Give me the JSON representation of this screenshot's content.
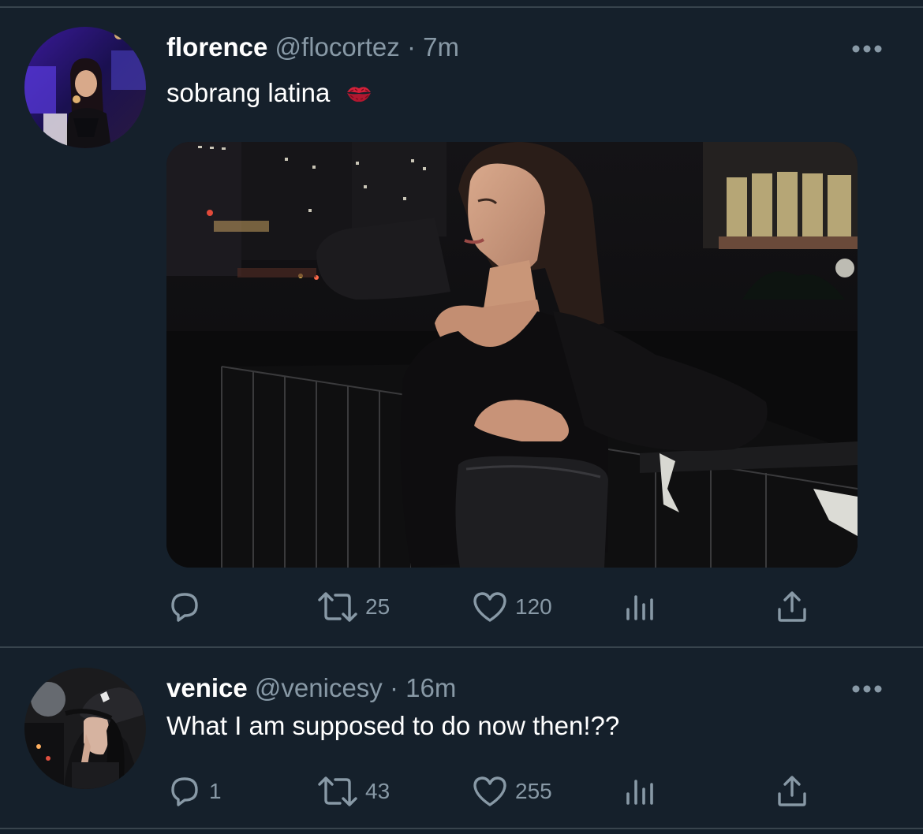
{
  "colors": {
    "background": "#15202b",
    "divider": "#38444d",
    "secondary_text": "#8899a6",
    "primary_text": "#ffffff",
    "emoji_red": "#d4213a"
  },
  "tweets": [
    {
      "name": "florence",
      "handle": "@flocortez",
      "separator": "·",
      "time": "7m",
      "text": "sobrang latina",
      "emoji": "kiss-mark-emoji",
      "has_media": true,
      "actions": {
        "reply_count": "",
        "retweet_count": "25",
        "like_count": "120"
      }
    },
    {
      "name": "venice",
      "handle": "@venicesy",
      "separator": "·",
      "time": "16m",
      "text": "What I am supposed to do now then!??",
      "has_media": false,
      "actions": {
        "reply_count": "1",
        "retweet_count": "43",
        "like_count": "255"
      }
    }
  ],
  "icons": {
    "more": "more-horizontal-icon",
    "reply": "reply-icon",
    "retweet": "retweet-icon",
    "like": "heart-icon",
    "analytics": "analytics-icon",
    "share": "share-icon"
  }
}
